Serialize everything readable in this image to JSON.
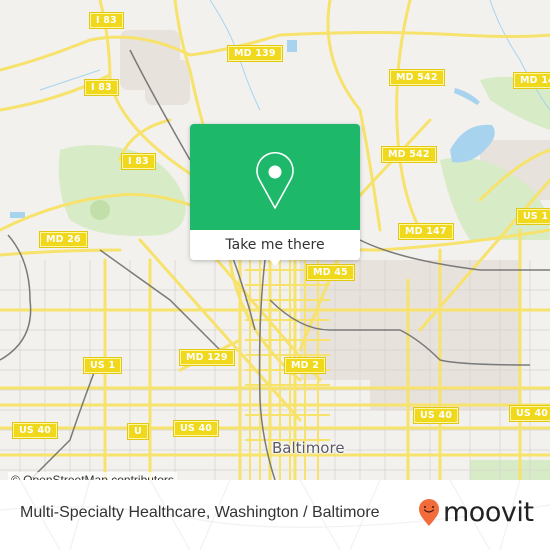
{
  "map": {
    "attribution": "© OpenStreetMap contributors",
    "city_label": "Baltimore",
    "shields": [
      {
        "label": "I 83"
      },
      {
        "label": "I 83"
      },
      {
        "label": "I 83"
      },
      {
        "label": "MD 139"
      },
      {
        "label": "MD 542"
      },
      {
        "label": "MD 542"
      },
      {
        "label": "MD 14"
      },
      {
        "label": "US 1"
      },
      {
        "label": "MD 147"
      },
      {
        "label": "MD 26"
      },
      {
        "label": "MD 45"
      },
      {
        "label": "MD 129"
      },
      {
        "label": "US 1"
      },
      {
        "label": "MD 2"
      },
      {
        "label": "US 40"
      },
      {
        "label": "U"
      },
      {
        "label": "US 40"
      },
      {
        "label": "US 40"
      },
      {
        "label": "US 40"
      }
    ],
    "colors": {
      "background": "#f2f1ee",
      "road": "#f7e26b",
      "park": "#d6ebc2",
      "water": "#a8d3ef",
      "rail": "#7a7a7a",
      "urban": "#e8e2dd"
    }
  },
  "popup": {
    "icon": "map-pin-icon",
    "button_label": "Take me there",
    "accent_color": "#1db86a"
  },
  "footer": {
    "place_title": "Multi-Specialty Healthcare, Washington / Baltimore",
    "brand": "moovit",
    "brand_icon": "moovit-pin-smile-icon",
    "brand_color": "#f26b3a"
  }
}
